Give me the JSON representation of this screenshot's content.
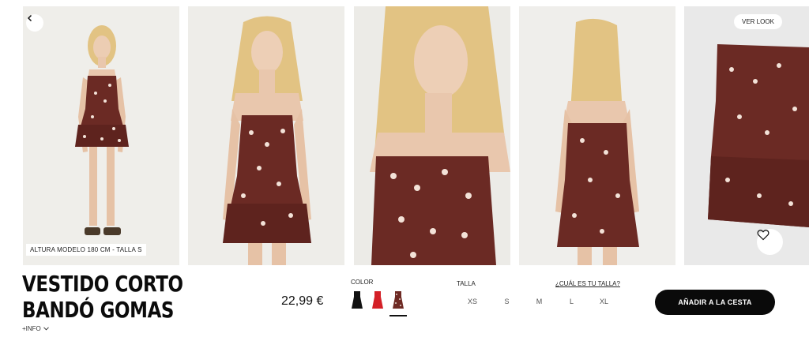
{
  "gallery": {
    "model_caption": "ALTURA MODELO 180 CM - TALLA S",
    "ver_look": "VER LOOK",
    "photos": [
      "model-full-front",
      "model-front-crop",
      "model-closeup",
      "model-back",
      "product-flat"
    ]
  },
  "product": {
    "title_line1": "VESTIDO CORTO",
    "title_line2": "BANDÓ GOMAS",
    "info_link": "+INFO",
    "price": "22,99 €"
  },
  "color": {
    "label": "COLOR",
    "swatches": [
      {
        "name": "black",
        "hex": "#111111",
        "selected": false
      },
      {
        "name": "red",
        "hex": "#d42027",
        "selected": false
      },
      {
        "name": "floral-burgundy",
        "hex": "#6e2a24",
        "selected": true
      }
    ]
  },
  "size": {
    "label": "TALLA",
    "guide_link": "¿CUÁL ES TU TALLA?",
    "options": [
      "XS",
      "S",
      "M",
      "L",
      "XL"
    ]
  },
  "cart": {
    "add_label": "AÑADIR A LA CESTA"
  },
  "colors": {
    "dress": "#6b2a24",
    "hair": "#e2c383",
    "skin": "#e9c7ad",
    "button": "#0a0a0a"
  }
}
